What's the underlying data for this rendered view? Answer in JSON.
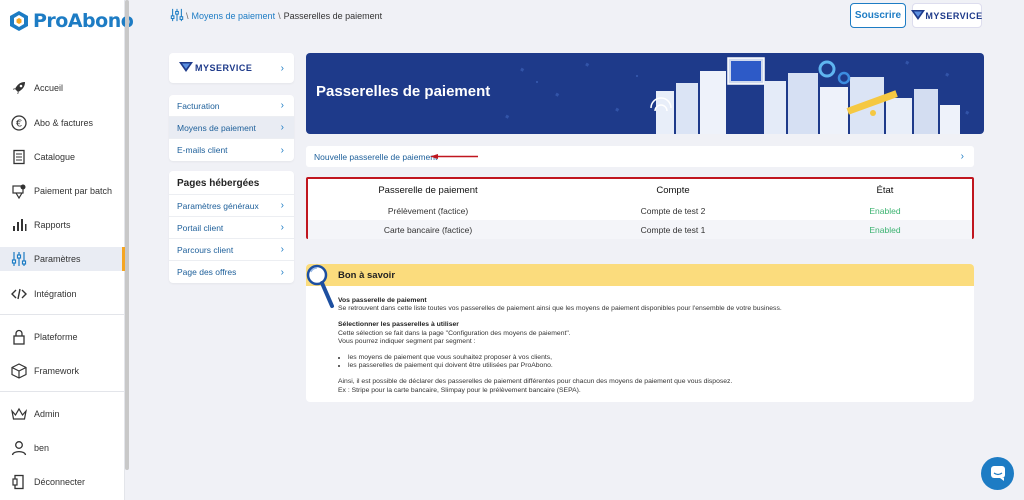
{
  "app": {
    "name": "ProAbono"
  },
  "sidebar": {
    "items": [
      {
        "label": "Accueil",
        "icon": "rocket-icon"
      },
      {
        "label": "Abo & factures",
        "icon": "euro-icon"
      },
      {
        "label": "Catalogue",
        "icon": "catalog-icon"
      },
      {
        "label": "Paiement par batch",
        "icon": "batch-payment-icon"
      },
      {
        "label": "Rapports",
        "icon": "chart-icon"
      },
      {
        "label": "Paramètres",
        "icon": "sliders-icon"
      },
      {
        "label": "Intégration",
        "icon": "code-icon"
      },
      {
        "label": "Plateforme",
        "icon": "lock-icon"
      },
      {
        "label": "Framework",
        "icon": "cube-icon"
      },
      {
        "label": "Admin",
        "icon": "crown-icon"
      },
      {
        "label": "ben",
        "icon": "user-icon"
      },
      {
        "label": "Déconnecter",
        "icon": "logout-icon"
      }
    ],
    "active": "Paramètres"
  },
  "breadcrumb": {
    "parent": "Moyens de paiement",
    "separator": "\\",
    "current": "Passerelles de paiement"
  },
  "header": {
    "subscribe_label": "Souscrire",
    "brand_label": "MYSERVICE"
  },
  "submenu": {
    "brand_label": "MYSERVICE",
    "group1": [
      {
        "label": "Facturation"
      },
      {
        "label": "Moyens de paiement",
        "selected": true
      },
      {
        "label": "E-mails client"
      }
    ],
    "hosted_title": "Pages hébergées",
    "group2": [
      {
        "label": "Paramètres généraux"
      },
      {
        "label": "Portail client"
      },
      {
        "label": "Parcours client"
      },
      {
        "label": "Page des offres"
      }
    ]
  },
  "banner": {
    "title": "Passerelles de paiement"
  },
  "new_gateway": {
    "label": "Nouvelle passerelle de paiement"
  },
  "table": {
    "headers": [
      "Passerelle de paiement",
      "Compte",
      "État"
    ],
    "rows": [
      [
        "Prélèvement (factice)",
        "Compte de test 2",
        "Enabled"
      ],
      [
        "Carte bancaire (factice)",
        "Compte de test 1",
        "Enabled"
      ]
    ]
  },
  "help": {
    "title": "Bon à savoir",
    "s1_title": "Vos passerelle de paiement",
    "s1_text": "Se retrouvent dans cette liste toutes vos passerelles de paiement ainsi que les moyens de paiement disponibles pour l'ensemble de votre business.",
    "s2_title": "Sélectionner les passerelles à utiliser",
    "s2_text1": "Cette sélection se fait dans la page \"Configuration des moyens de paiement\".",
    "s2_text2": "Vous pourrez indiquer segment par segment :",
    "bullets": [
      "les moyens de paiement que vous souhaitez proposer à vos clients,",
      "les passerelles de paiement qui doivent être utilisées par ProAbono."
    ],
    "s3_text1": "Ainsi, il est possible de déclarer des passerelles de paiement différentes pour chacun des moyens de paiement que vous disposez.",
    "s3_text2": "Ex : Stripe pour la carte bancaire, Slimpay pour le prélèvement bancaire (SEPA)."
  },
  "colors": {
    "accent": "#1d7cc4",
    "banner": "#1e3a8a",
    "highlight": "#c0161f",
    "help_header": "#fbdc7d",
    "enabled": "#3cb371"
  }
}
